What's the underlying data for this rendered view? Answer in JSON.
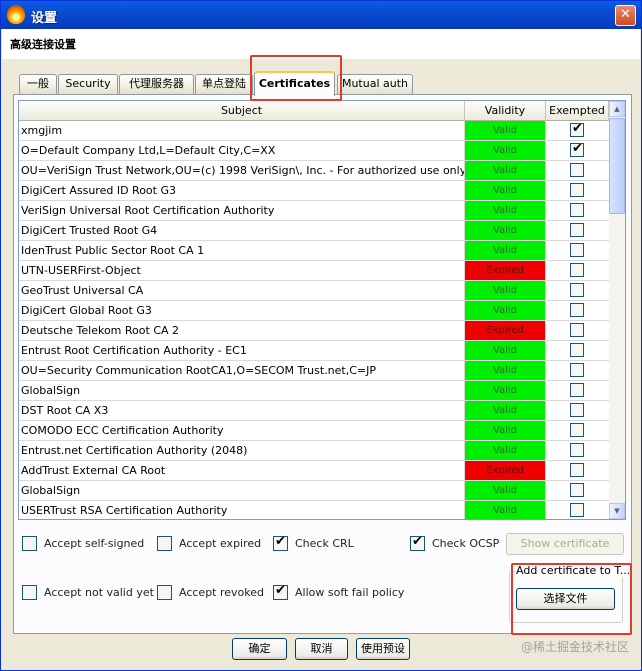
{
  "window": {
    "title": "设置",
    "close_glyph": "✕"
  },
  "header": {
    "title": "高级连接设置"
  },
  "tabs": [
    {
      "label": "一般"
    },
    {
      "label": "Security"
    },
    {
      "label": "代理服务器"
    },
    {
      "label": "单点登陆"
    },
    {
      "label": "Certificates"
    },
    {
      "label": "Mutual auth"
    }
  ],
  "active_tab": "Certificates",
  "table": {
    "columns": [
      "Subject",
      "Validity",
      "Exempted"
    ],
    "rows": [
      {
        "subject": "xmgjim",
        "validity": "Valid",
        "exempted": true
      },
      {
        "subject": "O=Default Company Ltd,L=Default City,C=XX",
        "validity": "Valid",
        "exempted": true
      },
      {
        "subject": "OU=VeriSign Trust Network,OU=(c) 1998 VeriSign\\, Inc. - For authorized use only,OU=Cla...",
        "validity": "Valid",
        "exempted": false
      },
      {
        "subject": "DigiCert Assured ID Root G3",
        "validity": "Valid",
        "exempted": false
      },
      {
        "subject": "VeriSign Universal Root Certification Authority",
        "validity": "Valid",
        "exempted": false
      },
      {
        "subject": "DigiCert Trusted Root G4",
        "validity": "Valid",
        "exempted": false
      },
      {
        "subject": "IdenTrust Public Sector Root CA 1",
        "validity": "Valid",
        "exempted": false
      },
      {
        "subject": "UTN-USERFirst-Object",
        "validity": "Expired",
        "exempted": false
      },
      {
        "subject": "GeoTrust Universal CA",
        "validity": "Valid",
        "exempted": false
      },
      {
        "subject": "DigiCert Global Root G3",
        "validity": "Valid",
        "exempted": false
      },
      {
        "subject": "Deutsche Telekom Root CA 2",
        "validity": "Expired",
        "exempted": false
      },
      {
        "subject": "Entrust Root Certification Authority - EC1",
        "validity": "Valid",
        "exempted": false
      },
      {
        "subject": "OU=Security Communication RootCA1,O=SECOM Trust.net,C=JP",
        "validity": "Valid",
        "exempted": false
      },
      {
        "subject": "GlobalSign",
        "validity": "Valid",
        "exempted": false
      },
      {
        "subject": "DST Root CA X3",
        "validity": "Valid",
        "exempted": false
      },
      {
        "subject": "COMODO ECC Certification Authority",
        "validity": "Valid",
        "exempted": false
      },
      {
        "subject": "Entrust.net Certification Authority (2048)",
        "validity": "Valid",
        "exempted": false
      },
      {
        "subject": "AddTrust External CA Root",
        "validity": "Expired",
        "exempted": false
      },
      {
        "subject": "GlobalSign",
        "validity": "Valid",
        "exempted": false
      },
      {
        "subject": "USERTrust RSA Certification Authority",
        "validity": "Valid",
        "exempted": false
      }
    ]
  },
  "options": {
    "accept_self_signed": {
      "label": "Accept self-signed",
      "checked": false
    },
    "accept_expired": {
      "label": "Accept expired",
      "checked": false
    },
    "check_crl": {
      "label": "Check CRL",
      "checked": true
    },
    "check_ocsp": {
      "label": "Check OCSP",
      "checked": true
    },
    "accept_not_valid_yet": {
      "label": "Accept not valid yet",
      "checked": false
    },
    "accept_revoked": {
      "label": "Accept revoked",
      "checked": false
    },
    "allow_soft_fail": {
      "label": "Allow soft fail policy",
      "checked": true
    }
  },
  "buttons": {
    "show_certificate": "Show certificate",
    "choose_file": "选择文件",
    "ok": "确定",
    "cancel": "取消",
    "apply": "使用预设"
  },
  "add_certificate_group": {
    "title": "Add certificate to T..."
  },
  "watermark": "@稀土掘金技术社区",
  "colors": {
    "valid": "#00ee00",
    "expired": "#ee0000",
    "highlight": "#e23b2e",
    "titlebar": "#0a5ee8"
  },
  "icons": {
    "window": "flame-icon",
    "checkmark": "✔",
    "scroll_up": "▲",
    "scroll_down": "▼"
  }
}
